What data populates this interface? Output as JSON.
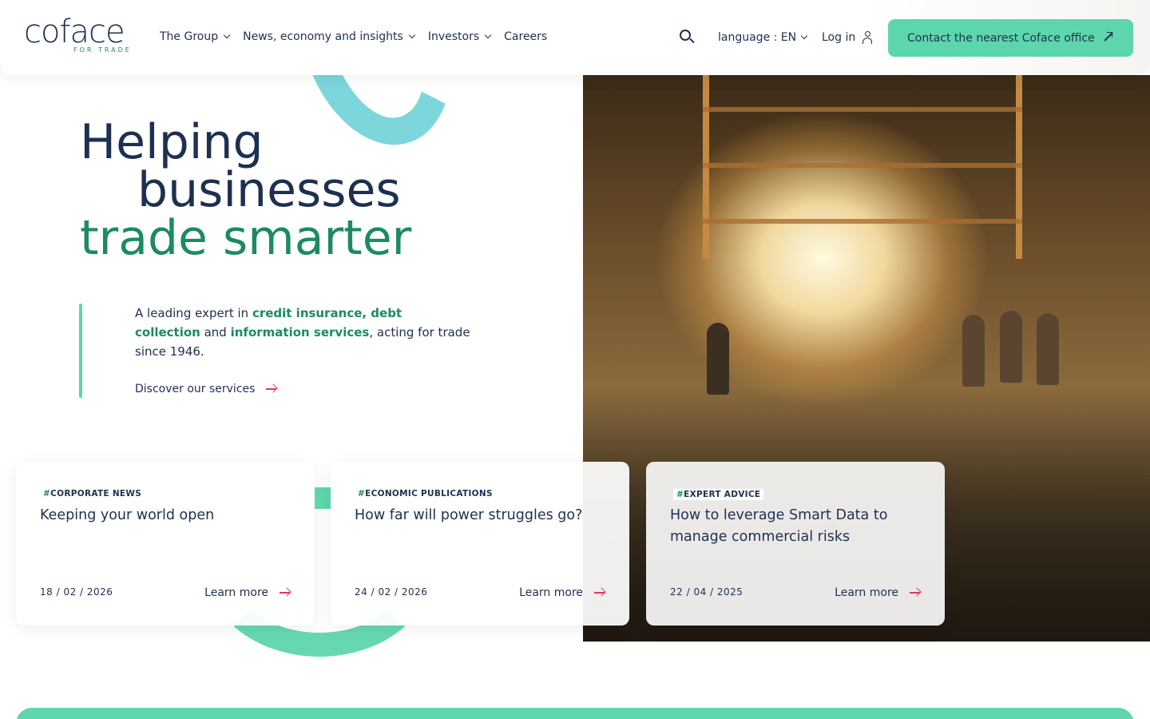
{
  "brand": {
    "logo_text": "coface",
    "logo_tagline": "FOR TRADE",
    "accent_green": "#1c8a62",
    "mint": "#5ed6ab",
    "navy": "#1e3050",
    "arrow_red": "#e4345f"
  },
  "nav": {
    "items": [
      {
        "label": "The Group",
        "has_dropdown": true
      },
      {
        "label": "News, economy and insights",
        "has_dropdown": true
      },
      {
        "label": "Investors",
        "has_dropdown": true
      },
      {
        "label": "Careers",
        "has_dropdown": false
      }
    ],
    "search_icon": "search-icon",
    "language_label": "language : EN",
    "login_label": "Log in",
    "contact_label": "Contact the nearest Coface office"
  },
  "hero": {
    "line1": "Helping",
    "line2": "businesses",
    "line3": "trade smarter",
    "intro_prefix": "A leading expert in ",
    "intro_bold1": "credit insurance, debt collection",
    "intro_mid": " and ",
    "intro_bold2": "information services",
    "intro_suffix": ", acting for trade since 1946.",
    "discover_label": "Discover our services"
  },
  "cards": [
    {
      "tag": "CORPORATE NEWS",
      "title": "Keeping your world open",
      "date": "18 / 02 / 2026",
      "cta": "Learn more"
    },
    {
      "tag": "ECONOMIC PUBLICATIONS",
      "title": "How far will power struggles go?",
      "date": "24 / 02 / 2026",
      "cta": "Learn more"
    },
    {
      "tag": "EXPERT ADVICE",
      "title": "How to leverage Smart Data to manage commercial risks",
      "date": "22 / 04 / 2025",
      "cta": "Learn more"
    }
  ]
}
